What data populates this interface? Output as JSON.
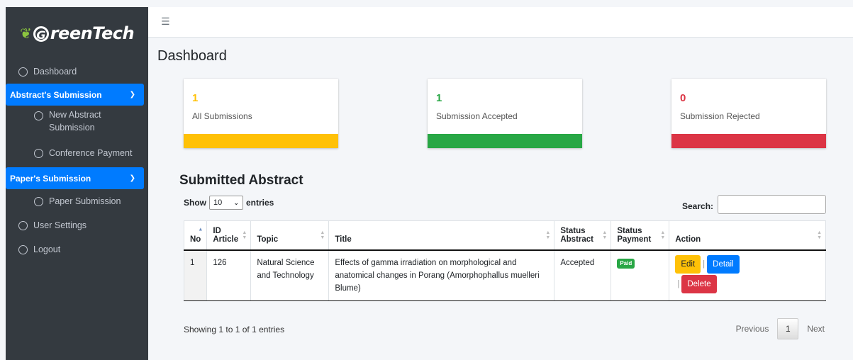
{
  "brand": {
    "name": "GreenTech",
    "initial": "G",
    "rest": "reenTech"
  },
  "sidebar": {
    "items": [
      {
        "label": "Dashboard"
      },
      {
        "label": "Abstract's Submission"
      },
      {
        "label": "New Abstract Submission"
      },
      {
        "label": "Conference Payment"
      },
      {
        "label": "Paper's Submission"
      },
      {
        "label": "Paper Submission"
      },
      {
        "label": "User Settings"
      },
      {
        "label": "Logout"
      }
    ]
  },
  "page": {
    "title": "Dashboard"
  },
  "cards": [
    {
      "value": "1",
      "label": "All Submissions",
      "color": "#ffc107"
    },
    {
      "value": "1",
      "label": "Submission Accepted",
      "color": "#28a745"
    },
    {
      "value": "0",
      "label": "Submission Rejected",
      "color": "#dc3545"
    }
  ],
  "table_section": {
    "title": "Submitted Abstract",
    "show_label": "Show",
    "entries_value": "10",
    "entries_label": "entries",
    "search_label": "Search:",
    "columns": [
      "No",
      "ID Article",
      "Topic",
      "Title",
      "Status Abstract",
      "Status Payment",
      "Action"
    ],
    "rows": [
      {
        "no": "1",
        "id": "126",
        "topic": "Natural Science and Technology",
        "title": "Effects of gamma irradiation on morphological and anatomical changes in Porang (Amorphophallus muelleri Blume)",
        "status_abstract": "Accepted",
        "status_payment": "Paid"
      }
    ],
    "actions": {
      "edit": "Edit",
      "detail": "Detail",
      "delete": "Delete",
      "separator": "|"
    },
    "info": "Showing 1 to 1 of 1 entries",
    "pager": {
      "previous": "Previous",
      "page": "1",
      "next": "Next"
    }
  },
  "colors": {
    "sidebar_bg": "#343a40",
    "primary": "#007bff",
    "brand_leaf": "#8cc63f"
  }
}
